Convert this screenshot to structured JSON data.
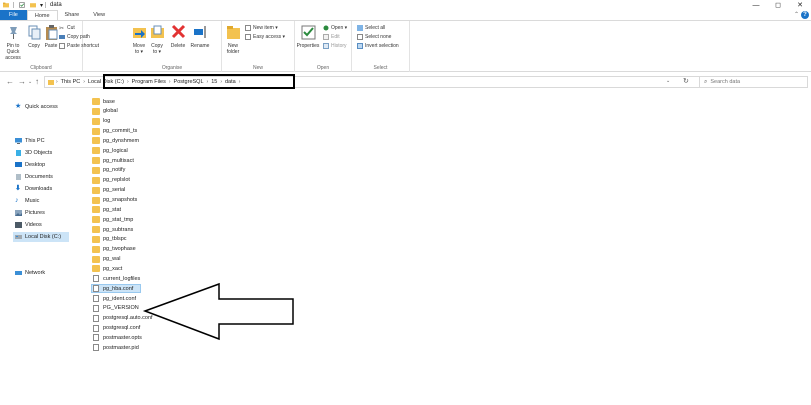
{
  "window": {
    "title": "data",
    "controls": [
      "—",
      "◻",
      "✕"
    ]
  },
  "tabs": [
    "File",
    "Home",
    "Share",
    "View"
  ],
  "ribbon": {
    "clipboard": {
      "label": "Clipboard",
      "pin": "Pin to Quick access",
      "copy": "Copy",
      "paste": "Paste",
      "cut": "Cut",
      "copy_path": "Copy path",
      "paste_shortcut": "Paste shortcut"
    },
    "organise": {
      "label": "Organise",
      "move_to": "Move to ▾",
      "copy_to": "Copy to ▾",
      "delete": "Delete",
      "rename": "Rename"
    },
    "new": {
      "label": "New",
      "new_folder": "New folder",
      "new_item": "New item ▾",
      "easy_access": "Easy access ▾"
    },
    "open": {
      "label": "Open",
      "properties": "Properties",
      "open": "Open ▾",
      "edit": "Edit",
      "history": "History"
    },
    "select": {
      "label": "Select",
      "select_all": "Select all",
      "select_none": "Select none",
      "invert": "Invert selection"
    }
  },
  "address": {
    "root": "This PC",
    "segments": [
      "Local Disk (C:)",
      "Program Files",
      "PostgreSQL",
      "15",
      "data"
    ]
  },
  "search": {
    "placeholder": "Search data"
  },
  "nav": [
    {
      "label": "Quick access",
      "icon": "star-icon"
    },
    {
      "label": "This PC",
      "icon": "pc-icon"
    },
    {
      "label": "3D Objects",
      "icon": "cube-icon"
    },
    {
      "label": "Desktop",
      "icon": "desktop-icon"
    },
    {
      "label": "Documents",
      "icon": "documents-icon"
    },
    {
      "label": "Downloads",
      "icon": "download-icon"
    },
    {
      "label": "Music",
      "icon": "music-icon"
    },
    {
      "label": "Pictures",
      "icon": "pictures-icon"
    },
    {
      "label": "Videos",
      "icon": "videos-icon"
    },
    {
      "label": "Local Disk (C:)",
      "icon": "drive-icon"
    },
    {
      "label": "Network",
      "icon": "network-icon"
    }
  ],
  "files": [
    {
      "name": "base",
      "type": "folder"
    },
    {
      "name": "global",
      "type": "folder"
    },
    {
      "name": "log",
      "type": "folder"
    },
    {
      "name": "pg_commit_ts",
      "type": "folder"
    },
    {
      "name": "pg_dynshmem",
      "type": "folder"
    },
    {
      "name": "pg_logical",
      "type": "folder"
    },
    {
      "name": "pg_multixact",
      "type": "folder"
    },
    {
      "name": "pg_notify",
      "type": "folder"
    },
    {
      "name": "pg_replslot",
      "type": "folder"
    },
    {
      "name": "pg_serial",
      "type": "folder"
    },
    {
      "name": "pg_snapshots",
      "type": "folder"
    },
    {
      "name": "pg_stat",
      "type": "folder"
    },
    {
      "name": "pg_stat_tmp",
      "type": "folder"
    },
    {
      "name": "pg_subtrans",
      "type": "folder"
    },
    {
      "name": "pg_tblspc",
      "type": "folder"
    },
    {
      "name": "pg_twophase",
      "type": "folder"
    },
    {
      "name": "pg_wal",
      "type": "folder"
    },
    {
      "name": "pg_xact",
      "type": "folder"
    },
    {
      "name": "current_logfiles",
      "type": "file"
    },
    {
      "name": "pg_hba.conf",
      "type": "file",
      "selected": true
    },
    {
      "name": "pg_ident.conf",
      "type": "file"
    },
    {
      "name": "PG_VERSION",
      "type": "file"
    },
    {
      "name": "postgresql.auto.conf",
      "type": "file"
    },
    {
      "name": "postgresql.conf",
      "type": "file"
    },
    {
      "name": "postmaster.opts",
      "type": "file"
    },
    {
      "name": "postmaster.pid",
      "type": "file"
    }
  ],
  "colors": {
    "accent": "#1a73c8",
    "folder": "#f3c24f",
    "selection": "#cce4f7"
  }
}
